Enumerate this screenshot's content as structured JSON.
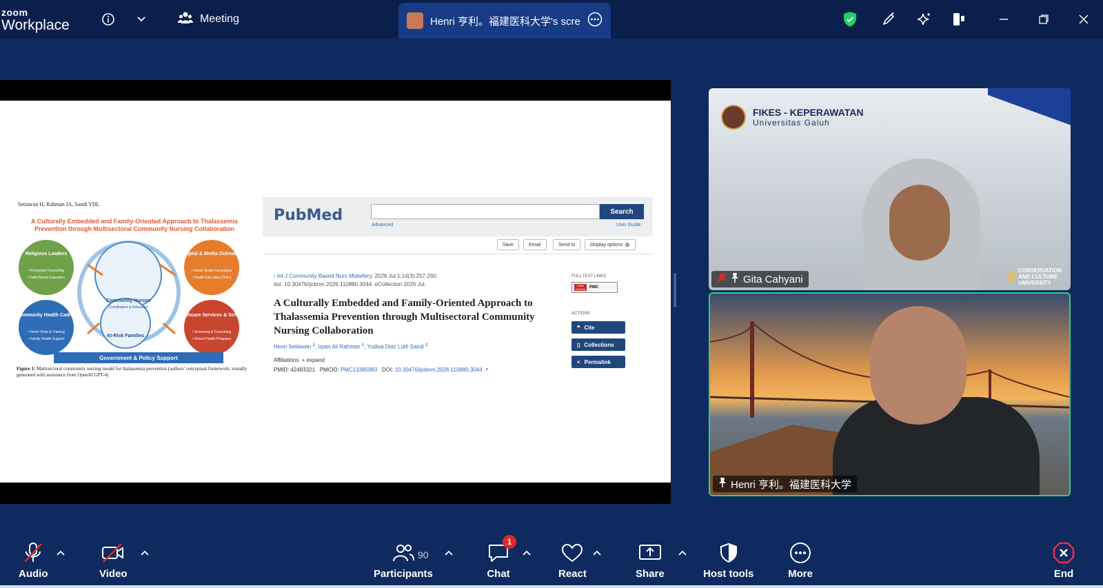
{
  "app": {
    "logo_line1": "zoom",
    "logo_line2": "Workplace",
    "meeting_label": "Meeting",
    "share_tab_title": "Henri 亨利。福建医科大学's screen"
  },
  "slide": {
    "figure": {
      "authors_line": "Setiawan H, Rahman IA, Sandi YDL",
      "title": "A Culturally Embedded and Family-Oriented Approach to Thalassemia Prevention through Multisectoral Community Nursing Collaboration",
      "nodes": {
        "religious": "Religious Leaders",
        "religious_items": [
          "• Premarital Counseling",
          "• Faith-Based Education"
        ],
        "digital": "Digital & Media Outreach",
        "digital_items": [
          "• Social Media Campaigns",
          "• Health Education Online"
        ],
        "center": "Community Nurses",
        "center_sub": "Coordinators & Educators",
        "community": "Community Health Cadres",
        "community_items": [
          "• Home Visits & Training",
          "• Family Health Support"
        ],
        "families": "At-Risk Families",
        "healthcare": "Healthcare Services & Schools",
        "healthcare_items": [
          "• Screening & Counseling",
          "• School Health Programs"
        ],
        "base": "Government & Policy Support"
      },
      "caption_label": "Figure 1:",
      "caption_text": "Multisectoral community nursing model for thalassemia prevention (authors' conceptual framework, visually generated with assistance from OpenAI GPT-4)"
    },
    "pubmed": {
      "logo": "PubMed",
      "search_button": "Search",
      "advanced": "Advanced",
      "user_guide": "User Guide",
      "actions_bar": [
        "Save",
        "Email",
        "Send to",
        "Display options"
      ],
      "journal_link": "Int J Community Based Nurs Midwifery",
      "journal_rest": ". 2026 Jul 1;14(3):257-260.",
      "doi_line": "doi: 10.30476/ijcbnm.2026.110880.3044. eCollection 2026 Jul.",
      "title": "A Culturally Embedded and Family-Oriented Approach to Thalassemia Prevention through Multisectoral Community Nursing Collaboration",
      "authors": [
        {
          "name": "Henri Setiawan",
          "sup": "1"
        },
        {
          "name": "Irpan Ali Rahman",
          "sup": "1"
        },
        {
          "name": "Yudisa Diaz Lutfi Sandi",
          "sup": "2"
        }
      ],
      "affiliations": "Affiliations",
      "expand": "+ expand",
      "pmid_label": "PMID: 42483321",
      "pmcid_label": "PMCID:",
      "pmcid_value": "PMC13385983",
      "doi_label": "DOI:",
      "doi_value": "10.30476/ijcbnm.2026.110880.3044",
      "full_text_links": "FULL TEXT LINKS",
      "free_full_text": "FREE Full text",
      "pmc": "PMC",
      "actions_heading": "ACTIONS",
      "side_buttons": [
        "Cite",
        "Collections",
        "Permalink"
      ]
    }
  },
  "participants": [
    {
      "name": "Gita Cahyani",
      "brand_line1": "FIKES - KEPERAWATAN",
      "brand_line2": "Universitas Galuh",
      "badge": "CONSERVATION AND CULTURE UNIVERSITY",
      "muted": true
    },
    {
      "name": "Henri 亨利。福建医科大学",
      "active_speaker": true
    }
  ],
  "toolbar": {
    "audio": "Audio",
    "video": "Video",
    "participants": "Participants",
    "participants_count": "90",
    "chat": "Chat",
    "chat_badge": "1",
    "react": "React",
    "share": "Share",
    "host_tools": "Host tools",
    "more": "More",
    "end": "End"
  },
  "colors": {
    "background": "#0e2a5e",
    "topbar": "#0b1f4d",
    "accent_green": "#29d08d",
    "end_red": "#e8304a",
    "pubmed_blue": "#20477c"
  }
}
